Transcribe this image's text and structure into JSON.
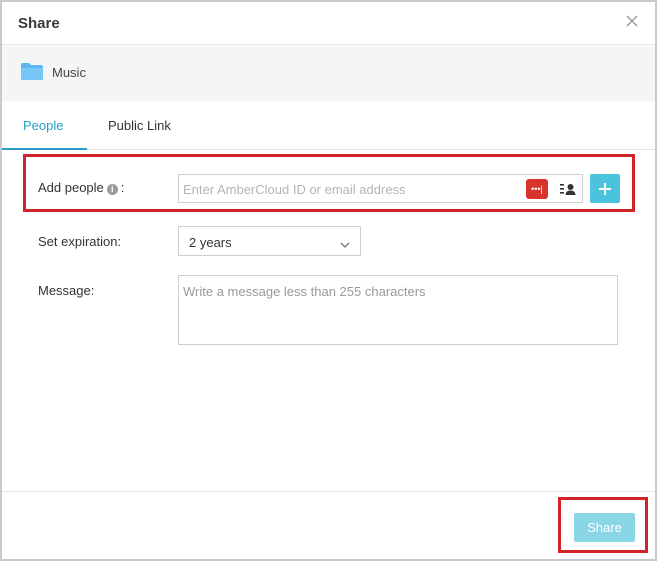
{
  "dialog": {
    "title": "Share"
  },
  "breadcrumb": {
    "folder_name": "Music"
  },
  "tabs": [
    {
      "label": "People",
      "active": true
    },
    {
      "label": "Public Link",
      "active": false
    }
  ],
  "form": {
    "add_people_label": "Add people",
    "add_people_colon": ":",
    "info_glyph": "i",
    "people_placeholder": "Enter AmberCloud ID or email address",
    "people_value": "",
    "lastpass_glyph": "•••|",
    "expiration_label": "Set expiration:",
    "expiration_value": "2 years",
    "message_label": "Message:",
    "message_placeholder": "Write a message less than 255 characters",
    "message_value": ""
  },
  "footer": {
    "share_label": "Share"
  },
  "colors": {
    "accent": "#2aa0c8",
    "add_button": "#4cc3dc",
    "share_button": "#8ad6e6",
    "highlight": "#d0232a",
    "lastpass": "#d8322d"
  },
  "icons": {
    "close": "close-icon",
    "folder": "folder-icon",
    "info": "info-icon",
    "lastpass": "lastpass-icon",
    "contacts": "contacts-icon",
    "add": "plus-icon",
    "dropdown": "chevron-down-icon"
  }
}
